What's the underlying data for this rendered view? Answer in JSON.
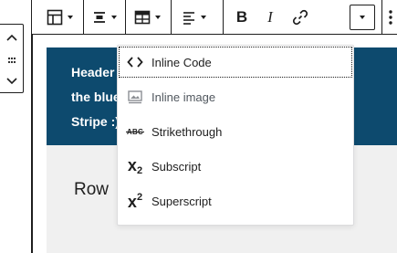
{
  "toolbar": {
    "buttons": [
      {
        "name": "table-icon"
      },
      {
        "name": "align-center-icon"
      },
      {
        "name": "edit-table-icon"
      },
      {
        "name": "align-left-icon"
      },
      {
        "name": "bold-icon",
        "label": "B"
      },
      {
        "name": "italic-icon",
        "label": "I"
      },
      {
        "name": "link-icon"
      },
      {
        "name": "more-rich-text-controls-icon"
      },
      {
        "name": "options-icon"
      }
    ]
  },
  "table": {
    "header_lines": [
      "Header",
      "the blue",
      "Stripe :)"
    ],
    "row_text": "Row"
  },
  "dropdown": {
    "items": [
      {
        "label": "Inline Code",
        "icon": "code-icon",
        "focused": true
      },
      {
        "label": "Inline image",
        "icon": "image-icon",
        "focused": false
      },
      {
        "label": "Strikethrough",
        "icon": "strikethrough-icon",
        "glyph": "ABC"
      },
      {
        "label": "Subscript",
        "icon": "subscript-icon",
        "glyph": "x",
        "sup_sub": "2"
      },
      {
        "label": "Superscript",
        "icon": "superscript-icon",
        "glyph": "x",
        "sup_sub": "2"
      }
    ]
  },
  "colors": {
    "header_bg": "#0d4a6e",
    "body_bg": "#f0f0f0",
    "text": "#1e1e1e",
    "menu_border": "#dcdcde"
  }
}
